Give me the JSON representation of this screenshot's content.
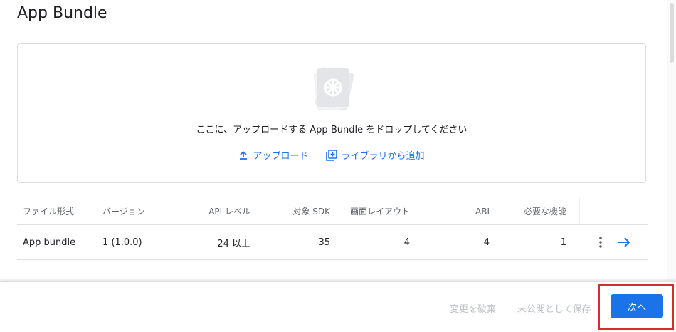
{
  "header": {
    "title": "App Bundle"
  },
  "dropzone": {
    "instruction": "ここに、アップロードする App Bundle をドロップしてください",
    "upload_label": "アップロード",
    "library_label": "ライブラリから追加"
  },
  "table": {
    "columns": [
      "ファイル形式",
      "バージョン",
      "API レベル",
      "対象 SDK",
      "画面レイアウト",
      "ABI",
      "必要な機能"
    ],
    "rows": [
      {
        "type": "App bundle",
        "version": "1 (1.0.0)",
        "api": "24 以上",
        "sdk": "35",
        "layout": "4",
        "abi": "4",
        "features": "1"
      }
    ]
  },
  "footer": {
    "discard_label": "変更を破棄",
    "save_draft_label": "未公開として保存",
    "next_label": "次へ"
  },
  "colors": {
    "accent": "#1a73e8",
    "highlight": "#d32f2f"
  }
}
